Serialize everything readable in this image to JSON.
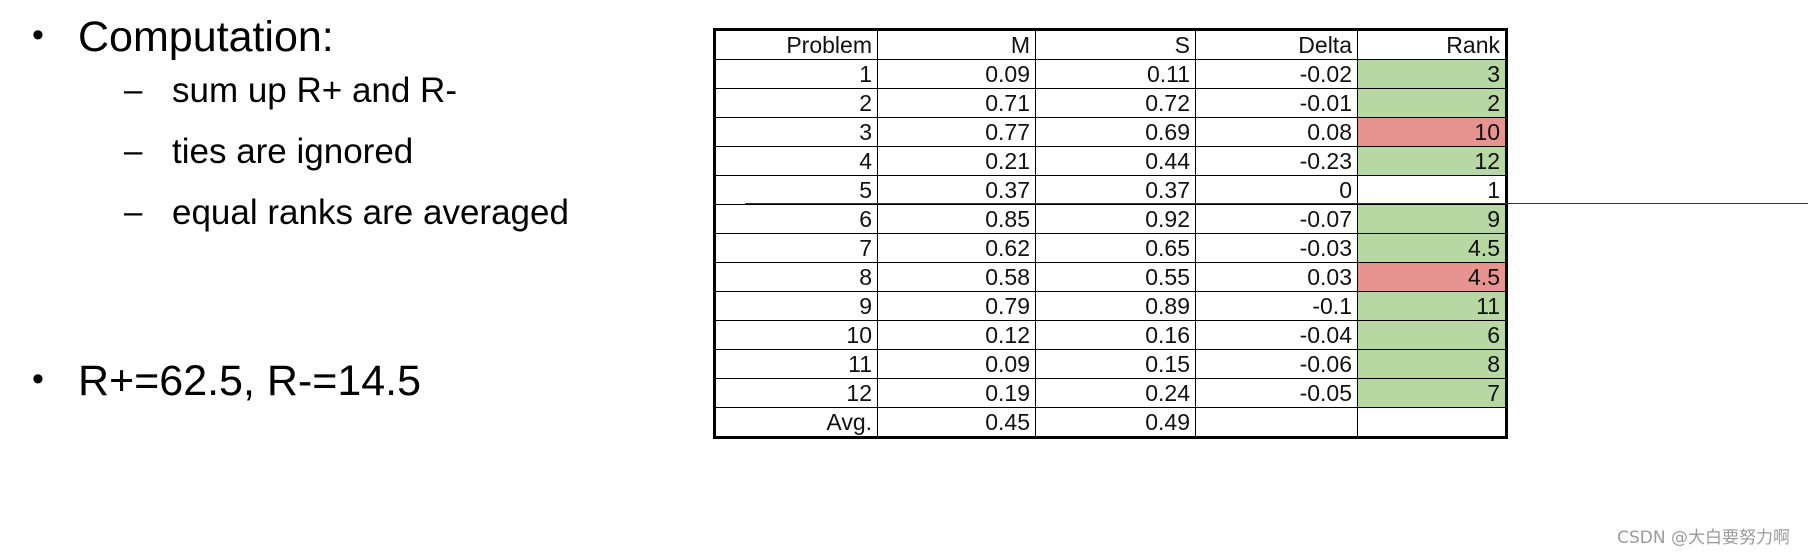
{
  "slide": {
    "bullet_marker": "•",
    "dash_marker": "–",
    "items": [
      {
        "text": "Computation:"
      },
      {
        "text": "R+=62.5, R-=14.5"
      }
    ],
    "sub_items": [
      {
        "text": "sum up R+ and R-"
      },
      {
        "text": "ties are ignored"
      },
      {
        "text": "equal ranks are averaged"
      }
    ]
  },
  "watermark": "CSDN @大白要努力啊",
  "colors": {
    "green_fill": "#b7d7a3",
    "red_fill": "#e79490",
    "grid": "#000000",
    "text": "#111111"
  },
  "chart_data": {
    "type": "table",
    "title": "",
    "columns": [
      "Problem",
      "M",
      "S",
      "Delta",
      "Rank"
    ],
    "rows": [
      {
        "problem": "1",
        "m": "0.09",
        "s": "0.11",
        "delta": "-0.02",
        "rank": "3",
        "rank_fill": "green"
      },
      {
        "problem": "2",
        "m": "0.71",
        "s": "0.72",
        "delta": "-0.01",
        "rank": "2",
        "rank_fill": "green"
      },
      {
        "problem": "3",
        "m": "0.77",
        "s": "0.69",
        "delta": "0.08",
        "rank": "10",
        "rank_fill": "red"
      },
      {
        "problem": "4",
        "m": "0.21",
        "s": "0.44",
        "delta": "-0.23",
        "rank": "12",
        "rank_fill": "green"
      },
      {
        "problem": "5",
        "m": "0.37",
        "s": "0.37",
        "delta": "0",
        "rank": "1",
        "rank_fill": "plain"
      },
      {
        "problem": "6",
        "m": "0.85",
        "s": "0.92",
        "delta": "-0.07",
        "rank": "9",
        "rank_fill": "green"
      },
      {
        "problem": "7",
        "m": "0.62",
        "s": "0.65",
        "delta": "-0.03",
        "rank": "4.5",
        "rank_fill": "green"
      },
      {
        "problem": "8",
        "m": "0.58",
        "s": "0.55",
        "delta": "0.03",
        "rank": "4.5",
        "rank_fill": "red"
      },
      {
        "problem": "9",
        "m": "0.79",
        "s": "0.89",
        "delta": "-0.1",
        "rank": "11",
        "rank_fill": "green"
      },
      {
        "problem": "10",
        "m": "0.12",
        "s": "0.16",
        "delta": "-0.04",
        "rank": "6",
        "rank_fill": "green"
      },
      {
        "problem": "11",
        "m": "0.09",
        "s": "0.15",
        "delta": "-0.06",
        "rank": "8",
        "rank_fill": "green"
      },
      {
        "problem": "12",
        "m": "0.19",
        "s": "0.24",
        "delta": "-0.05",
        "rank": "7",
        "rank_fill": "green"
      },
      {
        "problem": "Avg.",
        "m": "0.45",
        "s": "0.49",
        "delta": "",
        "rank": "",
        "rank_fill": "plain"
      }
    ]
  }
}
